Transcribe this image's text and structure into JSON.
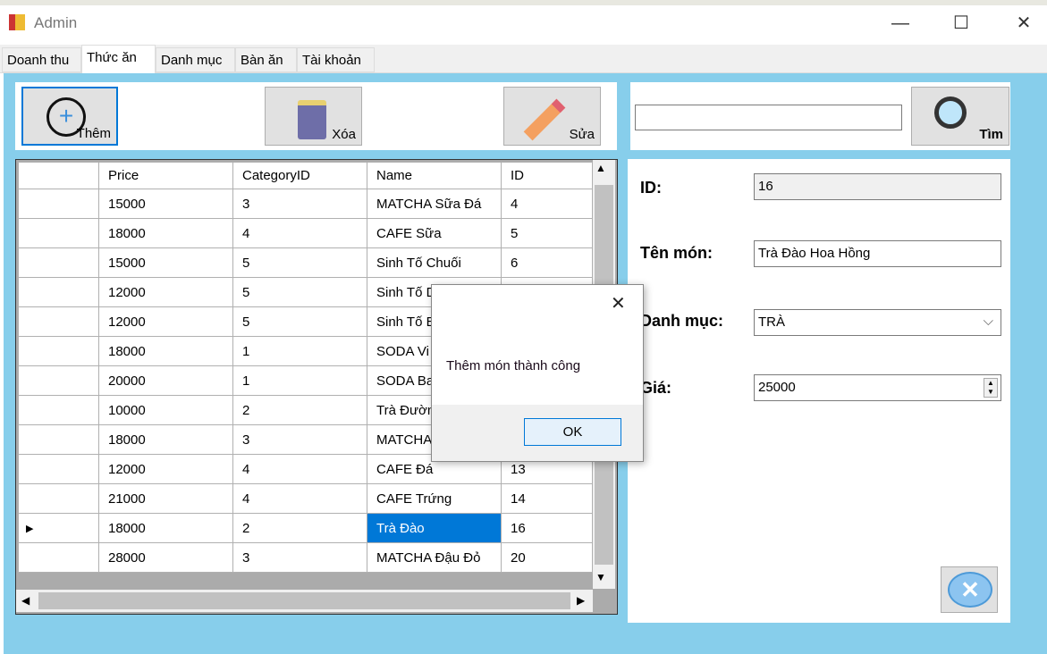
{
  "window": {
    "title": "Admin",
    "minimize": "—",
    "maximize": "☐",
    "close": "✕"
  },
  "tabs": [
    "Doanh thu",
    "Thức ăn",
    "Danh mục",
    "Bàn ăn",
    "Tài khoản"
  ],
  "toolbar": {
    "add": "Thêm",
    "delete": "Xóa",
    "edit": "Sửa"
  },
  "search": {
    "value": "",
    "button": "Tìm"
  },
  "grid": {
    "columns": [
      "Price",
      "CategoryID",
      "Name",
      "ID"
    ],
    "rows": [
      [
        "15000",
        "3",
        "MATCHA Sữa Đá",
        "4"
      ],
      [
        "18000",
        "4",
        "CAFE Sữa",
        "5"
      ],
      [
        "15000",
        "5",
        "Sinh Tố Chuối",
        "6"
      ],
      [
        "12000",
        "5",
        "Sinh Tố D",
        ""
      ],
      [
        "12000",
        "5",
        "Sinh Tố B",
        ""
      ],
      [
        "18000",
        "1",
        "SODA Vi",
        ""
      ],
      [
        "20000",
        "1",
        "SODA Ba",
        ""
      ],
      [
        "10000",
        "2",
        "Trà Đườn",
        ""
      ],
      [
        "18000",
        "3",
        "MATCHA",
        ""
      ],
      [
        "12000",
        "4",
        "CAFE Đá",
        "13"
      ],
      [
        "21000",
        "4",
        "CAFE Trứng",
        "14"
      ],
      [
        "18000",
        "2",
        "Trà Đào",
        "16"
      ],
      [
        "28000",
        "3",
        "MATCHA Đậu Đỏ",
        "20"
      ]
    ],
    "selected_row": 11
  },
  "details": {
    "id_label": "ID:",
    "id_value": "16",
    "name_label": "Tên món:",
    "name_value": "Trà Đào Hoa Hồng",
    "category_label": "Danh mục:",
    "category_value": "TRÀ",
    "price_label": "Giá:",
    "price_value": "25000"
  },
  "dialog": {
    "message": "Thêm món thành công",
    "ok": "OK",
    "close": "✕"
  }
}
